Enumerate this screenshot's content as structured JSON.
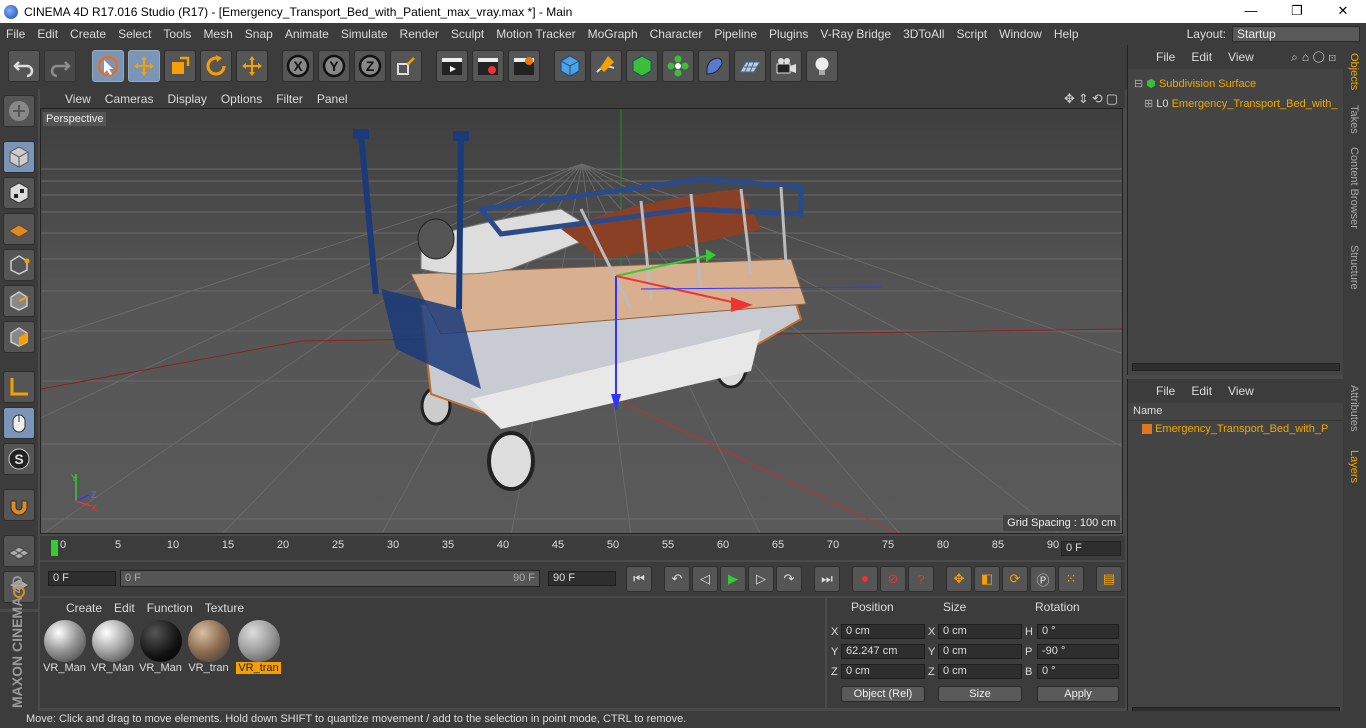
{
  "title_bar": {
    "text": "CINEMA 4D R17.016 Studio (R17) - [Emergency_Transport_Bed_with_Patient_max_vray.max *] - Main",
    "minimize": "—",
    "maximize": "❐",
    "close": "✕"
  },
  "menu": [
    "File",
    "Edit",
    "Create",
    "Select",
    "Tools",
    "Mesh",
    "Snap",
    "Animate",
    "Simulate",
    "Render",
    "Sculpt",
    "Motion Tracker",
    "MoGraph",
    "Character",
    "Pipeline",
    "Plugins",
    "V-Ray Bridge",
    "3DToAll",
    "Script",
    "Window",
    "Help"
  ],
  "layout": {
    "label": "Layout:",
    "value": "Startup"
  },
  "viewport": {
    "menu": [
      "View",
      "Cameras",
      "Display",
      "Options",
      "Filter",
      "Panel"
    ],
    "label": "Perspective",
    "grid_spacing": "Grid Spacing : 100 cm"
  },
  "timeline": {
    "ticks": [
      "0",
      "5",
      "10",
      "15",
      "20",
      "25",
      "30",
      "35",
      "40",
      "45",
      "50",
      "55",
      "60",
      "65",
      "70",
      "75",
      "80",
      "85",
      "90"
    ],
    "current_frame": "0 F"
  },
  "transport": {
    "start": "0 F",
    "slider_start": "0 F",
    "slider_end": "90 F",
    "end": "90 F"
  },
  "materials": {
    "menu": [
      "Create",
      "Edit",
      "Function",
      "Texture"
    ],
    "items": [
      {
        "label": "VR_Man",
        "selected": false
      },
      {
        "label": "VR_Man",
        "selected": false
      },
      {
        "label": "VR_Man",
        "selected": false
      },
      {
        "label": "VR_tran",
        "selected": false
      },
      {
        "label": "VR_tran",
        "selected": true
      }
    ]
  },
  "coordinates": {
    "headers": {
      "position": "Position",
      "size": "Size",
      "rotation": "Rotation"
    },
    "rows": [
      {
        "pos_axis": "X",
        "pos": "0 cm",
        "size_axis": "X",
        "size": "0 cm",
        "rot_axis": "H",
        "rot": "0 °"
      },
      {
        "pos_axis": "Y",
        "pos": "62.247 cm",
        "size_axis": "Y",
        "size": "0 cm",
        "rot_axis": "P",
        "rot": "-90 °"
      },
      {
        "pos_axis": "Z",
        "pos": "0 cm",
        "size_axis": "Z",
        "size": "0 cm",
        "rot_axis": "B",
        "rot": "0 °"
      }
    ],
    "mode": "Object (Rel)",
    "size_mode": "Size",
    "apply": "Apply"
  },
  "objects": {
    "menu": [
      "File",
      "Edit",
      "View"
    ],
    "items": [
      {
        "name": "Subdivision Surface"
      },
      {
        "name": "Emergency_Transport_Bed_with_"
      }
    ]
  },
  "layers": {
    "menu": [
      "File",
      "Edit",
      "View"
    ],
    "header": "Name",
    "items": [
      {
        "name": "Emergency_Transport_Bed_with_P",
        "color": "#e07820"
      }
    ]
  },
  "side_tabs": [
    "Objects",
    "Takes",
    "Content Browser",
    "Structure",
    "Attributes",
    "Layers"
  ],
  "brand": "MAXON CINEMA 4D",
  "status": "Move: Click and drag to move elements. Hold down SHIFT to quantize movement / add to the selection in point mode, CTRL to remove."
}
